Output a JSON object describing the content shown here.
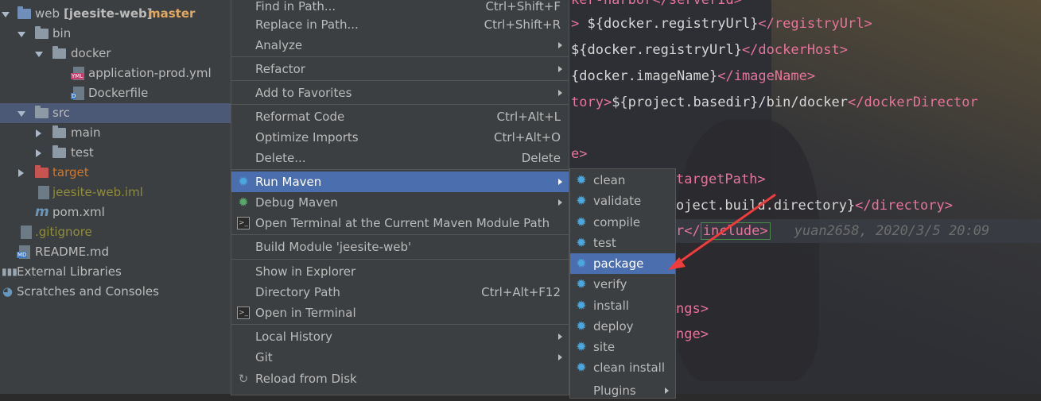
{
  "tree": {
    "items": [
      {
        "label": "web",
        "branch": "[jeesite-web]",
        "git": "master"
      },
      {
        "label": "bin"
      },
      {
        "label": "docker"
      },
      {
        "label": "application-prod.yml"
      },
      {
        "label": "Dockerfile"
      },
      {
        "label": "src"
      },
      {
        "label": "main"
      },
      {
        "label": "test"
      },
      {
        "label": "target"
      },
      {
        "label": "jeesite-web.iml"
      },
      {
        "label": "pom.xml"
      },
      {
        "label": ".gitignore"
      },
      {
        "label": "README.md"
      },
      {
        "label": "External Libraries"
      },
      {
        "label": "Scratches and Consoles"
      }
    ]
  },
  "menu": {
    "items": [
      {
        "label": "Find in Path...",
        "shortcut": "Ctrl+Shift+F"
      },
      {
        "label": "Replace in Path...",
        "shortcut": "Ctrl+Shift+R"
      },
      {
        "label": "Analyze"
      },
      {
        "label": "Refactor"
      },
      {
        "label": "Add to Favorites"
      },
      {
        "label": "Reformat Code",
        "shortcut": "Ctrl+Alt+L"
      },
      {
        "label": "Optimize Imports",
        "shortcut": "Ctrl+Alt+O"
      },
      {
        "label": "Delete...",
        "shortcut": "Delete"
      },
      {
        "label": "Run Maven"
      },
      {
        "label": "Debug Maven"
      },
      {
        "label": "Open Terminal at the Current Maven Module Path"
      },
      {
        "label": "Build Module 'jeesite-web'"
      },
      {
        "label": "Show in Explorer"
      },
      {
        "label": "Directory Path",
        "shortcut": "Ctrl+Alt+F12"
      },
      {
        "label": "Open in Terminal"
      },
      {
        "label": "Local History"
      },
      {
        "label": "Git"
      },
      {
        "label": "Reload from Disk"
      }
    ]
  },
  "submenu": {
    "items": [
      {
        "label": "clean"
      },
      {
        "label": "validate"
      },
      {
        "label": "compile"
      },
      {
        "label": "test"
      },
      {
        "label": "package"
      },
      {
        "label": "verify"
      },
      {
        "label": "install"
      },
      {
        "label": "deploy"
      },
      {
        "label": "site"
      },
      {
        "label": "clean install"
      },
      {
        "label": "Plugins"
      }
    ]
  },
  "editor": {
    "lines": [
      {
        "tag1": "ker-harbor</",
        "val": "",
        "tag2": "serverId>"
      },
      {
        "tag1": "> ",
        "val": "${docker.registryUrl}",
        "tag2": "</registryUrl>"
      },
      {
        "tag1": "",
        "val": "${docker.registryUrl}",
        "tag2": "</dockerHost>"
      },
      {
        "tag1": "",
        "val": "{docker.imageName}",
        "tag2": "</imageName>"
      },
      {
        "tag1": "tory>",
        "val": "${project.basedir}/bin/docker",
        "tag2": "</dockerDirector"
      },
      {
        "tag1": "e>",
        "val": "",
        "tag2": ""
      },
      {
        "tag1": "targetPath>",
        "val": "",
        "tag2": ""
      },
      {
        "tag1": "",
        "val": "oject.build.directory}",
        "tag2": "</directory>"
      },
      {
        "tag1": "r</",
        "val": "",
        "tag2": "include>"
      },
      {
        "tag1": "ngs>",
        "val": "",
        "tag2": ""
      },
      {
        "tag1": "nge>",
        "val": "",
        "tag2": ""
      }
    ],
    "blame": "yuan2658, 2020/3/5 20:09"
  },
  "colors": {
    "tree_bg": "#3c3f41",
    "selection": "#4b6eaf",
    "xml_tag": "#e8739a",
    "arrow": "#f03c3c"
  }
}
